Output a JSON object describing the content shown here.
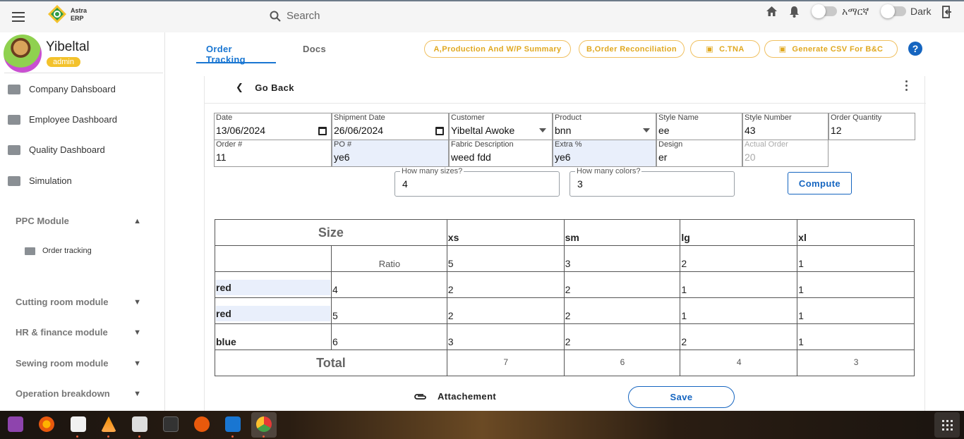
{
  "header": {
    "logo_line1": "Astra",
    "logo_line2": "ERP",
    "search_placeholder": "Search",
    "lang_label": "አማርኛ",
    "dark_label": "Dark"
  },
  "sidebar": {
    "user_name": "Yibeltal",
    "user_role": "admin",
    "items": [
      {
        "label": "Company Dahsboard",
        "icon": "store-icon"
      },
      {
        "label": "Employee Dashboard",
        "icon": "badge-icon"
      },
      {
        "label": "Quality Dashboard",
        "icon": "hd-icon"
      },
      {
        "label": "Simulation",
        "icon": "laptop-icon"
      }
    ],
    "ppc_module": "PPC Module",
    "ppc_sub_item": "Order tracking",
    "modules": [
      "Cutting room module",
      "HR & finance module",
      "Sewing room module",
      "Operation breakdown"
    ]
  },
  "tabs": {
    "active": "Order Tracking",
    "inactive": "Docs"
  },
  "actions": {
    "production": "A,Production And W/P Summary",
    "reconciliation": "B,Order Reconciliation",
    "tna": "C.TNA",
    "csv": "Generate CSV For B&C",
    "help": "?"
  },
  "form": {
    "go_back": "Go Back",
    "date_label": "Date",
    "date_value": "13/06/2024",
    "shipment_label": "Shipment Date",
    "shipment_value": "26/06/2024",
    "customer_label": "Customer",
    "customer_value": "Yibeltal Awoke",
    "product_label": "Product",
    "product_value": "bnn",
    "style_name_label": "Style Name",
    "style_name_value": "ee",
    "style_number_label": "Style Number",
    "style_number_value": "43",
    "order_qty_label": "Order Quantity",
    "order_qty_value": "12",
    "order_no_label": "Order #",
    "order_no_value": "11",
    "po_label": "PO #",
    "po_value": "ye6",
    "fabric_label": "Fabric Description",
    "fabric_value": "weed fdd",
    "extra_label": "Extra %",
    "extra_value": "ye6",
    "design_label": "Design",
    "design_value": "er",
    "actual_label": "Actual Order",
    "actual_value": "20",
    "sizes_label": "How many sizes?",
    "sizes_value": "4",
    "colors_label": "How many colors?",
    "colors_value": "3",
    "compute": "Compute"
  },
  "grid": {
    "size_header": "Size",
    "sizes": [
      "xs",
      "sm",
      "lg",
      "xl"
    ],
    "ratio_label": "Ratio",
    "ratios": [
      "5",
      "3",
      "2",
      "1"
    ],
    "rows": [
      {
        "color": "red",
        "ratio": "4",
        "values": [
          "2",
          "2",
          "1",
          "1"
        ]
      },
      {
        "color": "red",
        "ratio": "5",
        "values": [
          "2",
          "2",
          "1",
          "1"
        ]
      },
      {
        "color": "blue",
        "ratio": "6",
        "values": [
          "3",
          "2",
          "2",
          "1"
        ]
      }
    ],
    "total_label": "Total",
    "totals": [
      "7",
      "6",
      "4",
      "3"
    ]
  },
  "footer": {
    "attach": "Attachement",
    "save": "Save"
  }
}
